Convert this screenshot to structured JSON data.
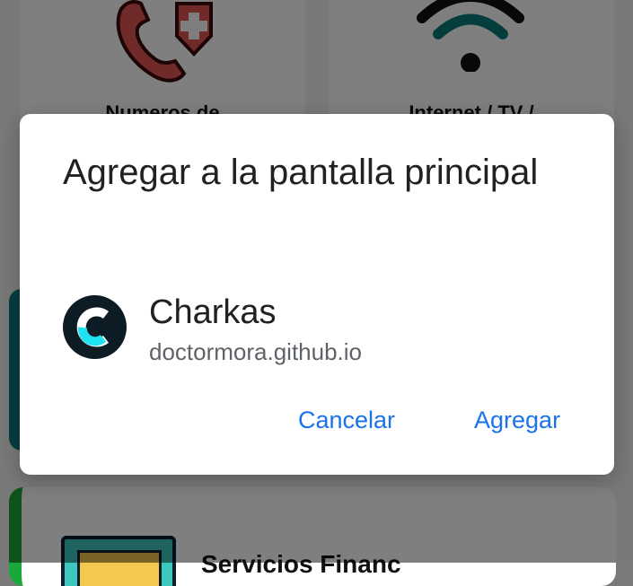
{
  "background": {
    "tiles": [
      {
        "label": "Numeros de"
      },
      {
        "label": "Internet / TV /"
      }
    ],
    "bottom_card": {
      "title": "Servicios Financ"
    }
  },
  "dialog": {
    "title": "Agregar a la pantalla principal",
    "app": {
      "name": "Charkas",
      "url": "doctormora.github.io",
      "icon": "charkas-logo-icon"
    },
    "buttons": {
      "cancel": "Cancelar",
      "add": "Agregar"
    }
  },
  "colors": {
    "accent": "#1a73e8",
    "title_text": "#202124",
    "secondary_text": "#5f6368",
    "icon_bg": "#0d1b24",
    "icon_accent": "#1de3f0"
  }
}
